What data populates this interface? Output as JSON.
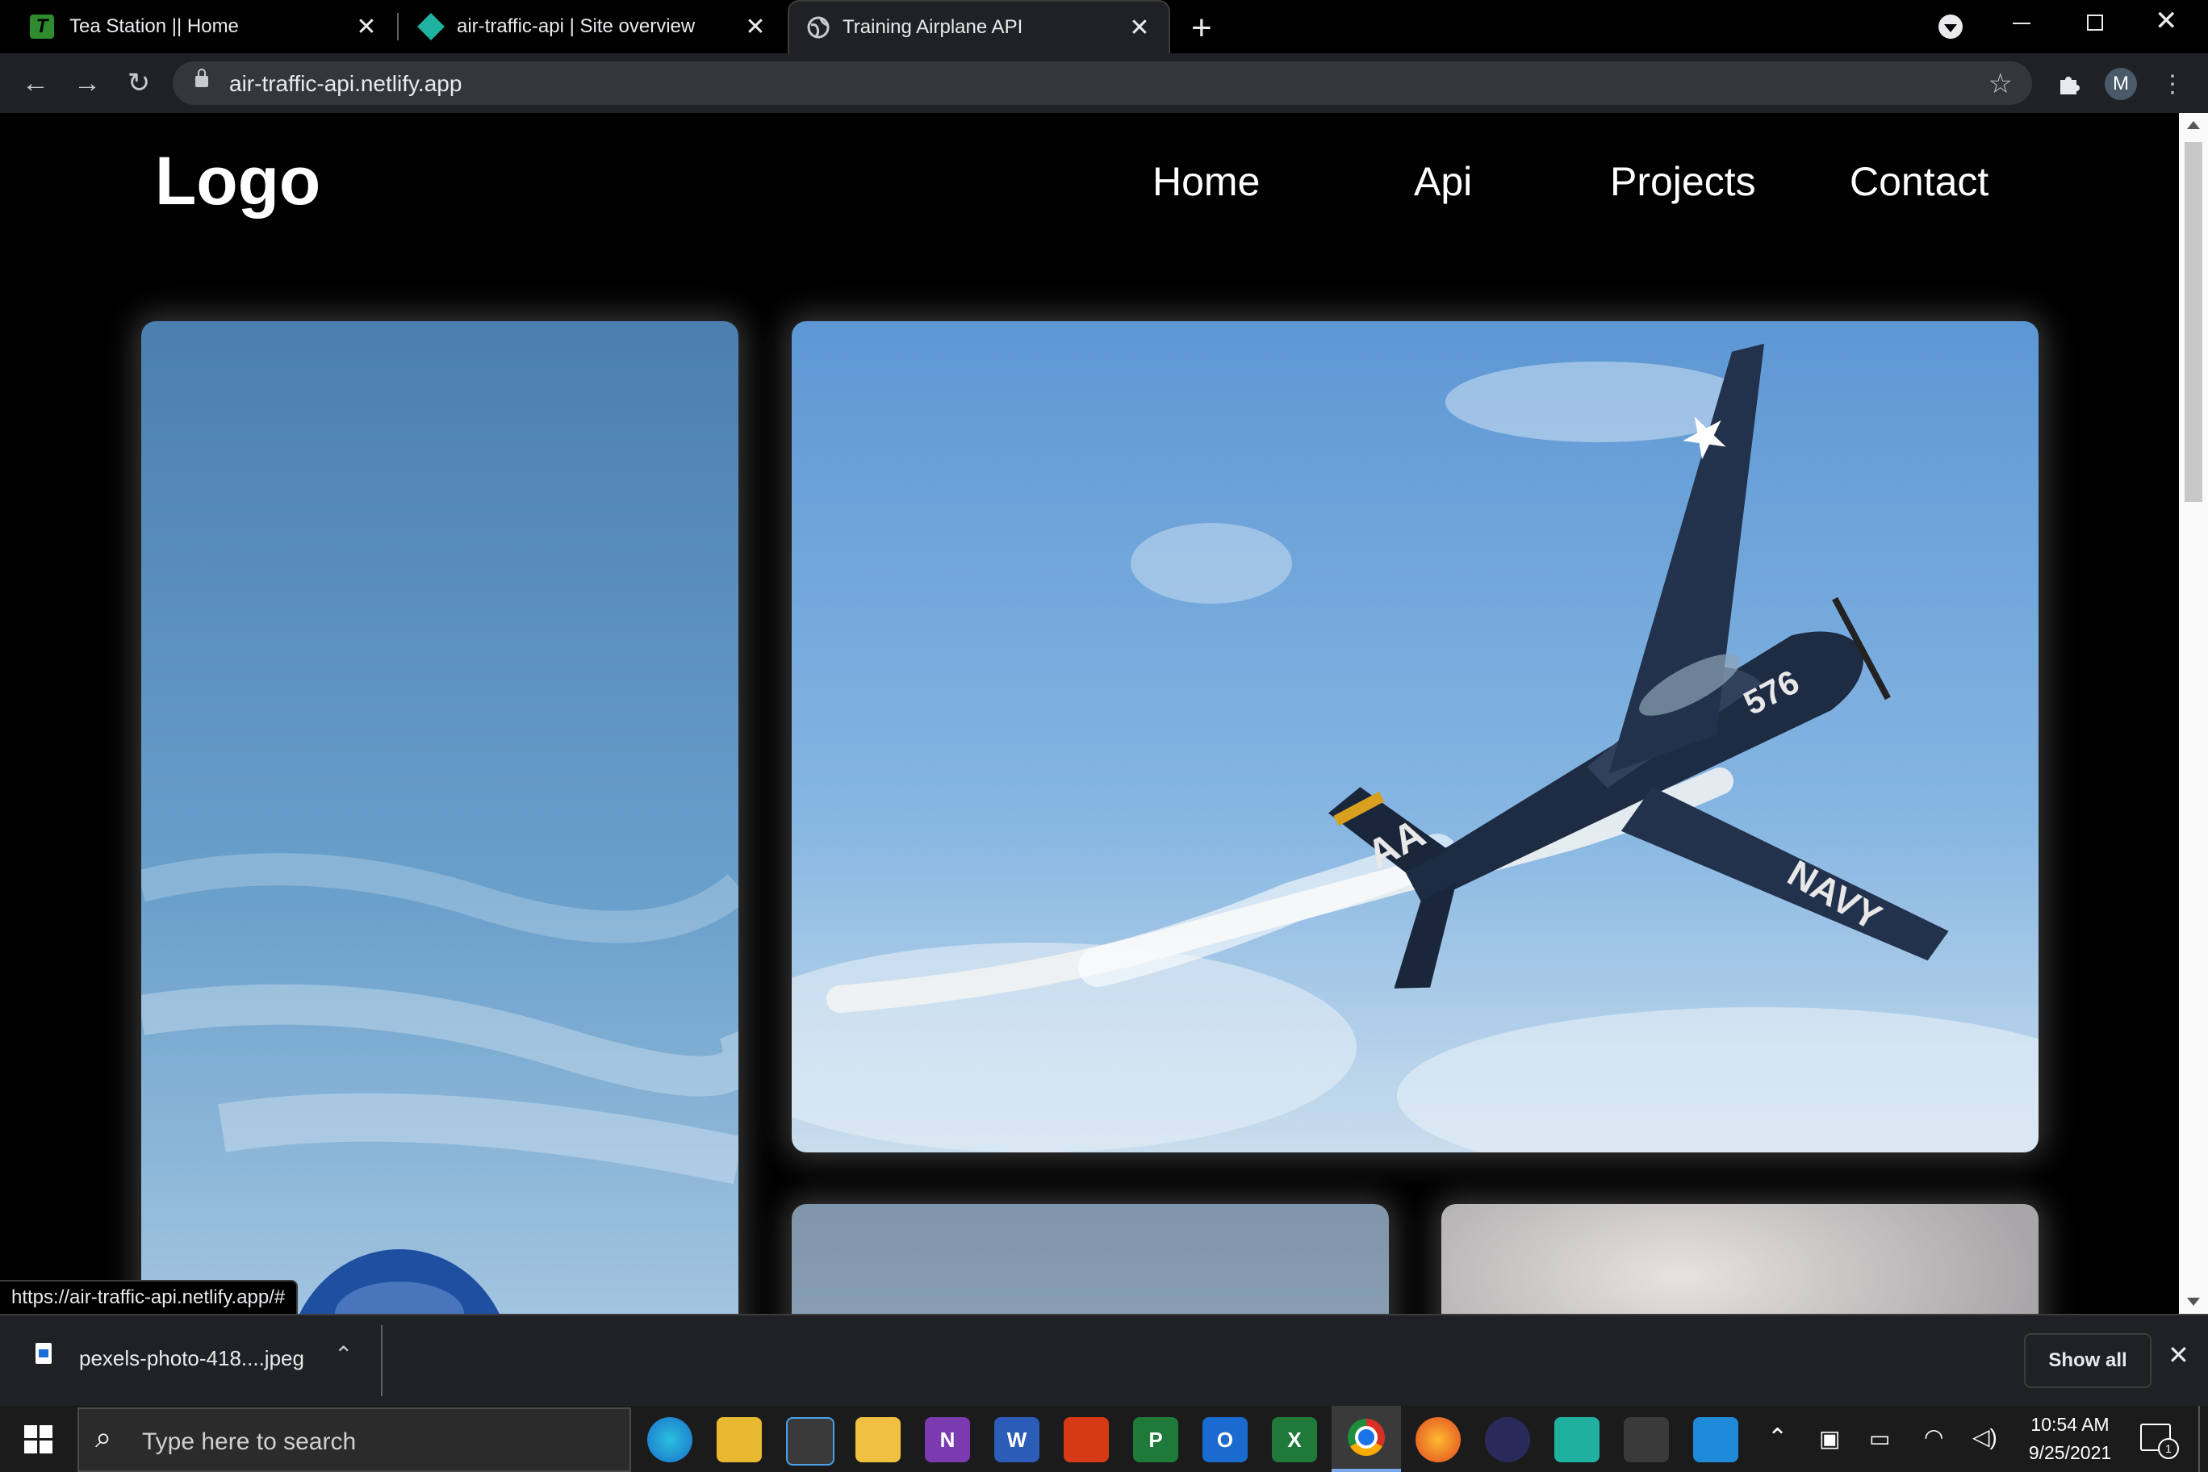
{
  "browser": {
    "tabs": [
      {
        "title": "Tea Station || Home",
        "favicon": "tea-station-favicon"
      },
      {
        "title": "air-traffic-api | Site overview",
        "favicon": "netlify-favicon"
      },
      {
        "title": "Training Airplane API",
        "favicon": "globe-favicon",
        "active": true
      }
    ],
    "url": "air-traffic-api.netlify.app",
    "profile_initial": "M"
  },
  "site": {
    "logo": "Logo",
    "nav": [
      "Home",
      "Api",
      "Projects",
      "Contact"
    ],
    "hero_tail_text": "AA",
    "hero_fuselage_number": "576",
    "hero_wing_text": "NAVY"
  },
  "status_url": "https://air-traffic-api.netlify.app/#",
  "downloads": {
    "file_name": "pexels-photo-418....jpeg",
    "show_all": "Show all"
  },
  "taskbar": {
    "search_placeholder": "Type here to search",
    "time": "10:54 AM",
    "date": "9/25/2021",
    "notification_count": "1"
  },
  "colors": {
    "page_bg": "#000000",
    "chrome_bg": "#202124",
    "sky": "#6fa6da"
  }
}
